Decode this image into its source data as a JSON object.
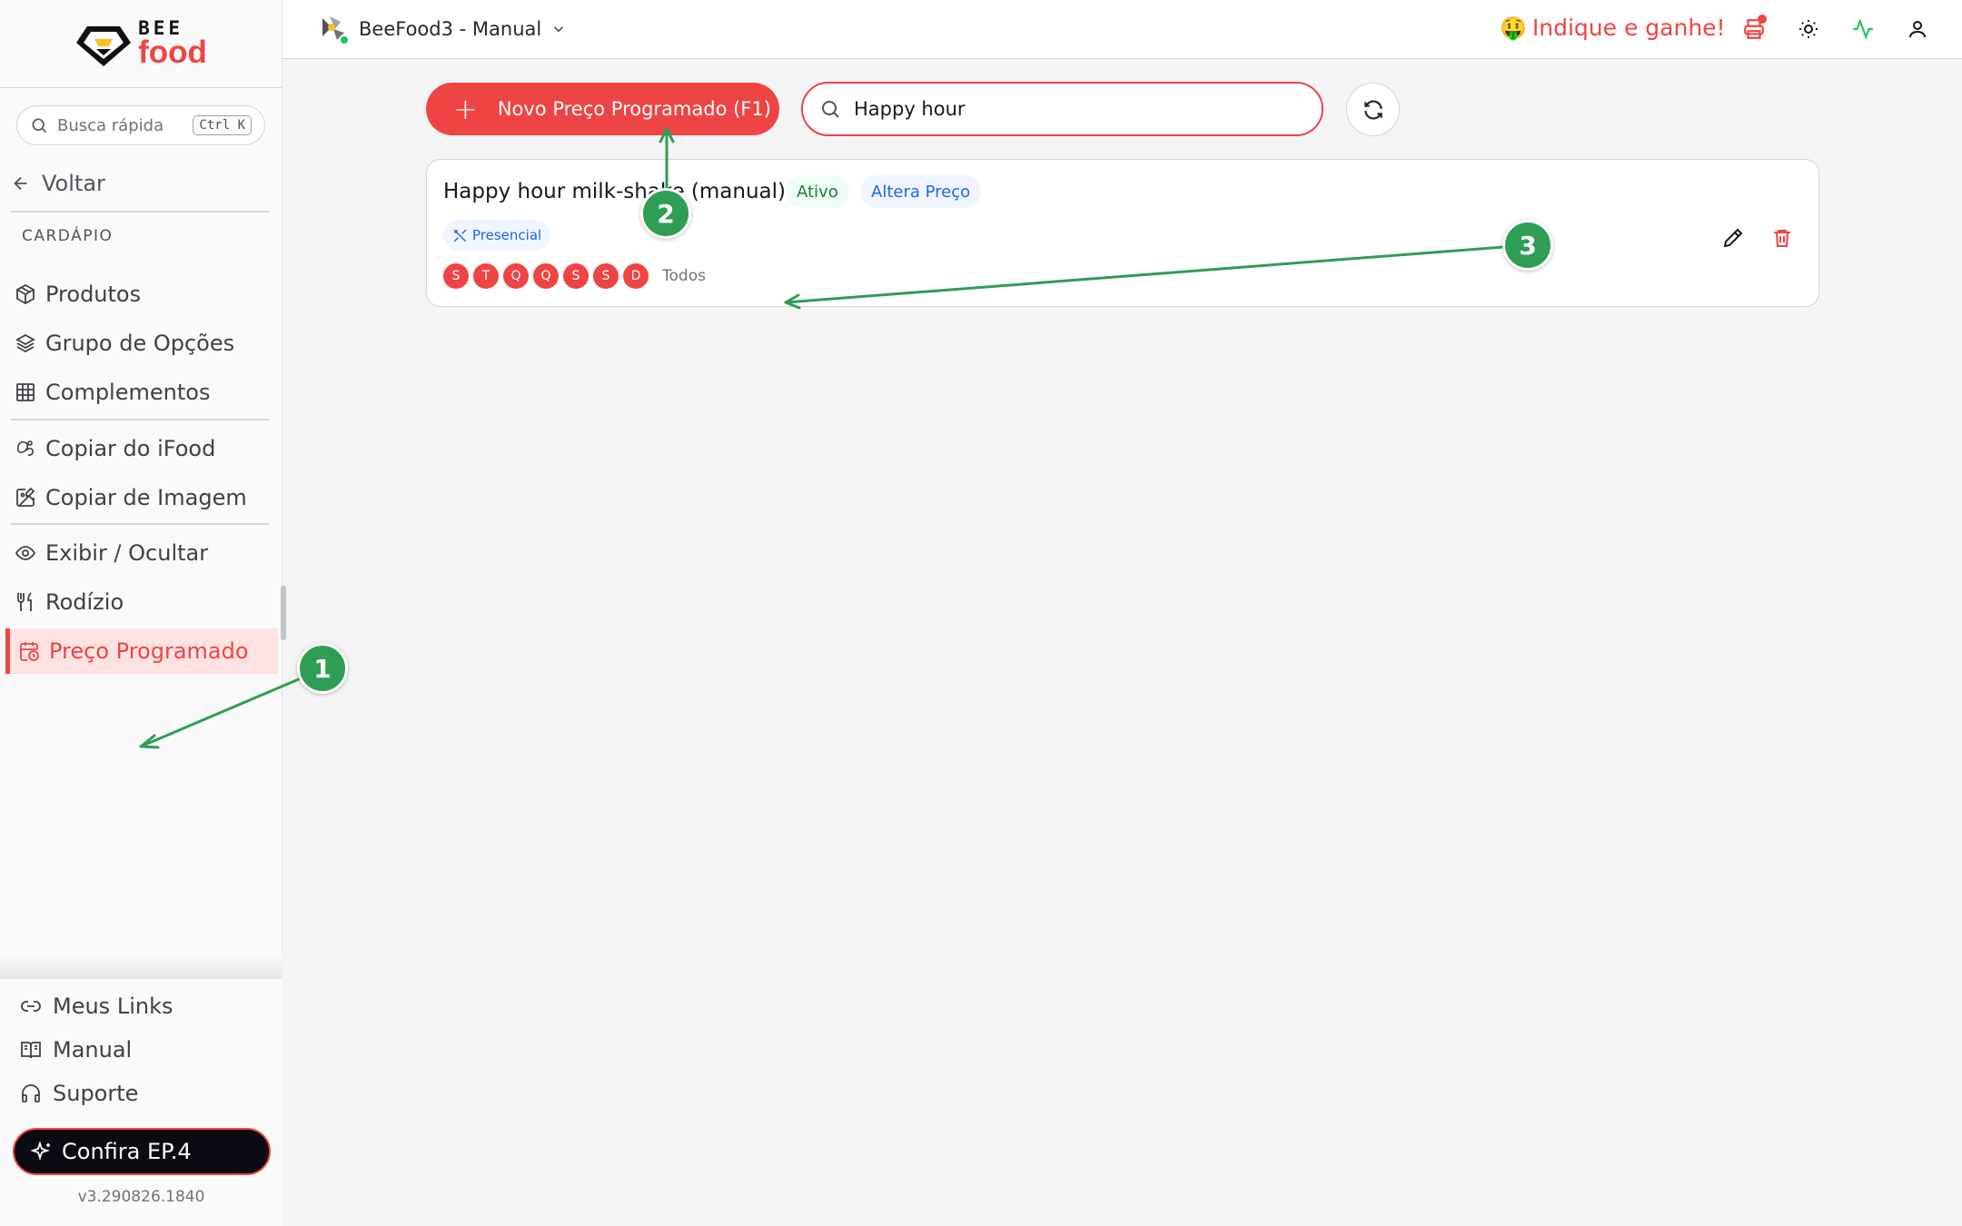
{
  "sidebar": {
    "logo_top": "BEE",
    "logo_bottom": "food",
    "quick_search_placeholder": "Busca rápida",
    "quick_search_shortcut": "Ctrl K",
    "back_label": "Voltar",
    "section_label": "CARDÁPIO",
    "items": [
      {
        "label": "Produtos",
        "icon": "box-icon"
      },
      {
        "label": "Grupo de Opções",
        "icon": "layers-icon"
      },
      {
        "label": "Complementos",
        "icon": "grid-icon"
      },
      {
        "label": "Copiar do iFood",
        "icon": "ifood-icon"
      },
      {
        "label": "Copiar de Imagem",
        "icon": "image-edit-icon"
      },
      {
        "label": "Exibir / Ocultar",
        "icon": "eye-icon"
      },
      {
        "label": "Rodízio",
        "icon": "utensils-icon"
      },
      {
        "label": "Preço Programado",
        "icon": "calendar-clock-icon",
        "active": true
      }
    ],
    "bottom_items": [
      {
        "label": "Meus Links",
        "icon": "link-icon"
      },
      {
        "label": "Manual",
        "icon": "book-icon"
      },
      {
        "label": "Suporte",
        "icon": "headset-icon"
      }
    ],
    "promo_button": "Confira EP.4",
    "version": "v3.290826.1840"
  },
  "topbar": {
    "store_name": "BeeFood3 - Manual",
    "referral_emoji": "🤑",
    "referral_label": "Indique e ganhe!",
    "icons": [
      "printer-icon",
      "sun-icon",
      "activity-icon",
      "user-icon"
    ]
  },
  "toolbar": {
    "new_button_label": "Novo Preço Programado (F1)",
    "search_value": "Happy hour"
  },
  "card": {
    "title": "Happy hour milk-shake (manual)",
    "status_badge": "Ativo",
    "type_badge": "Altera Preço",
    "channel_tag": "Presencial",
    "days": [
      "S",
      "T",
      "Q",
      "Q",
      "S",
      "S",
      "D"
    ],
    "days_summary": "Todos"
  },
  "annotations": [
    "1",
    "2",
    "3"
  ],
  "colors": {
    "accent": "#ef4444",
    "annotation": "#2e9e54",
    "active_bg": "#fee2e2"
  }
}
